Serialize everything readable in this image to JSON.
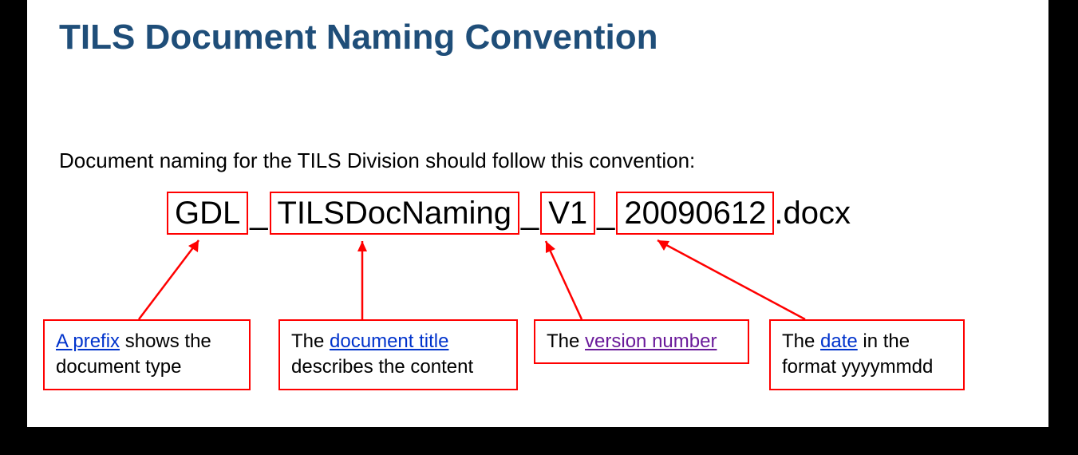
{
  "title": "TILS Document Naming Convention",
  "intro": "Document naming for the TILS Division should follow this convention:",
  "filename": {
    "prefix": "GDL",
    "sep": "_",
    "title": "TILSDocNaming",
    "version": "V1",
    "date": "20090612",
    "ext": ".docx"
  },
  "callouts": {
    "prefix": {
      "link": "A prefix",
      "rest": "  shows the document type"
    },
    "title": {
      "pre": "The ",
      "link": "document title",
      "rest": " describes the content"
    },
    "version": {
      "pre": "The ",
      "link": "version number"
    },
    "date": {
      "pre": "The ",
      "link": "date",
      "rest": " in the format yyyymmdd"
    }
  },
  "colors": {
    "heading": "#1f4e79",
    "box_border": "#ff0000",
    "link_blue": "#0033cc",
    "link_visited": "#6a1a9a"
  }
}
